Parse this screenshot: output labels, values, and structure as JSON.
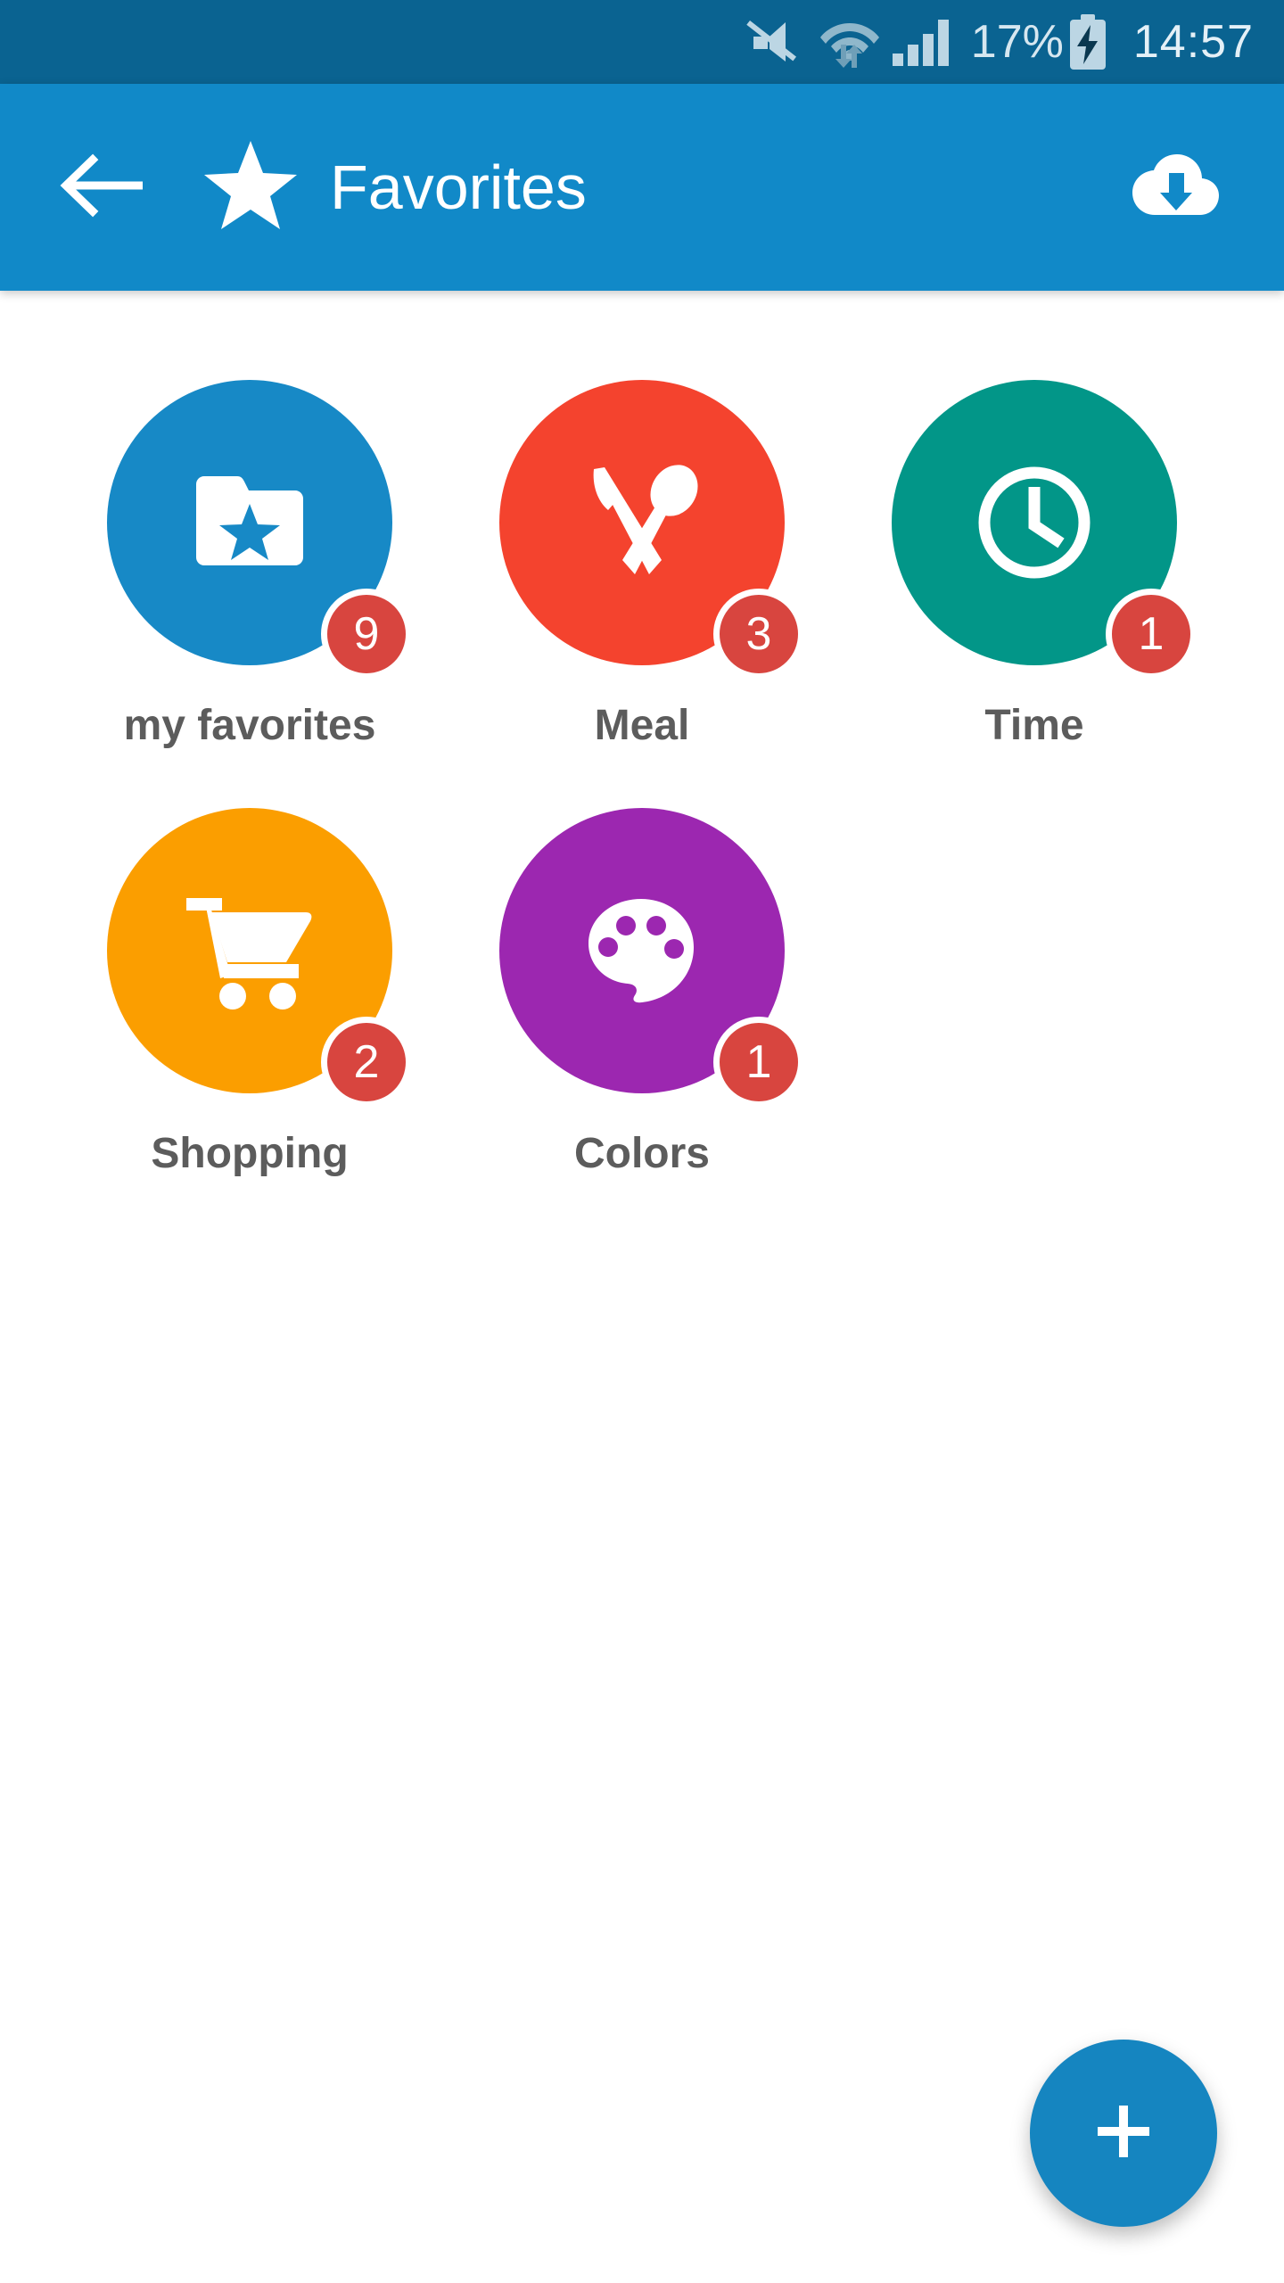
{
  "statusbar": {
    "background": "#0a6391",
    "mute_icon": "mute-icon",
    "wifi_icon": "wifi-transfer-icon",
    "signal_icon": "cellular-signal-icon",
    "battery_percent": "17%",
    "battery_icon": "battery-charging-icon",
    "time": "14:57"
  },
  "appbar": {
    "background": "#1189c8",
    "back_icon": "arrow-back-icon",
    "brand_icon": "star-icon",
    "title": "Favorites",
    "action_icon": "cloud-download-icon"
  },
  "grid": {
    "items": [
      {
        "label": "my favorites",
        "badge": "9",
        "color": "#1789c6",
        "icon": "folder-star-icon"
      },
      {
        "label": "Meal",
        "badge": "3",
        "color": "#f4432e",
        "icon": "cutlery-icon"
      },
      {
        "label": "Time",
        "badge": "1",
        "color": "#029688",
        "icon": "clock-icon"
      },
      {
        "label": "Shopping",
        "badge": "2",
        "color": "#fb9e00",
        "icon": "shopping-cart-icon"
      },
      {
        "label": "Colors",
        "badge": "1",
        "color": "#9c27b0",
        "icon": "palette-icon"
      }
    ],
    "badge_color": "#d8453f",
    "label_color": "#5c5c5c"
  },
  "fab": {
    "icon": "plus-icon",
    "color": "#1585c0",
    "label": "+"
  }
}
